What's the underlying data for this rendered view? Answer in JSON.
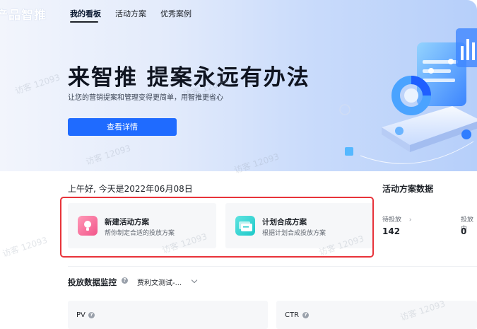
{
  "nav": {
    "logo": "产品智推",
    "items": [
      {
        "label": "我的看板",
        "active": true
      },
      {
        "label": "活动方案",
        "active": false
      },
      {
        "label": "优秀案例",
        "active": false
      }
    ]
  },
  "hero": {
    "title": "来智推 提案永远有办法",
    "subtitle": "让您的营销提案和管理变得更简单，用智推更省心",
    "button": "查看详情"
  },
  "greeting": "上午好, 今天是2022年06月08日",
  "quick_actions": [
    {
      "title": "新建活动方案",
      "desc": "帮你制定合适的投放方案",
      "icon": "lightbulb-icon",
      "color": "#f2558a"
    },
    {
      "title": "计划合成方案",
      "desc": "根据计划合成投放方案",
      "icon": "cards-icon",
      "color": "#1cc9c9"
    }
  ],
  "activity_stats": {
    "title": "活动方案数据",
    "items": [
      {
        "label": "待投放",
        "value": "142"
      },
      {
        "label": "投放中",
        "value": "0"
      }
    ]
  },
  "monitor": {
    "title": "投放数据监控",
    "selector": "贾利文测试-...",
    "metrics": [
      "PV",
      "CTR"
    ]
  },
  "watermark": "访客 12093",
  "colors": {
    "primary": "#1f6bff",
    "highlight": "#e8333a"
  }
}
